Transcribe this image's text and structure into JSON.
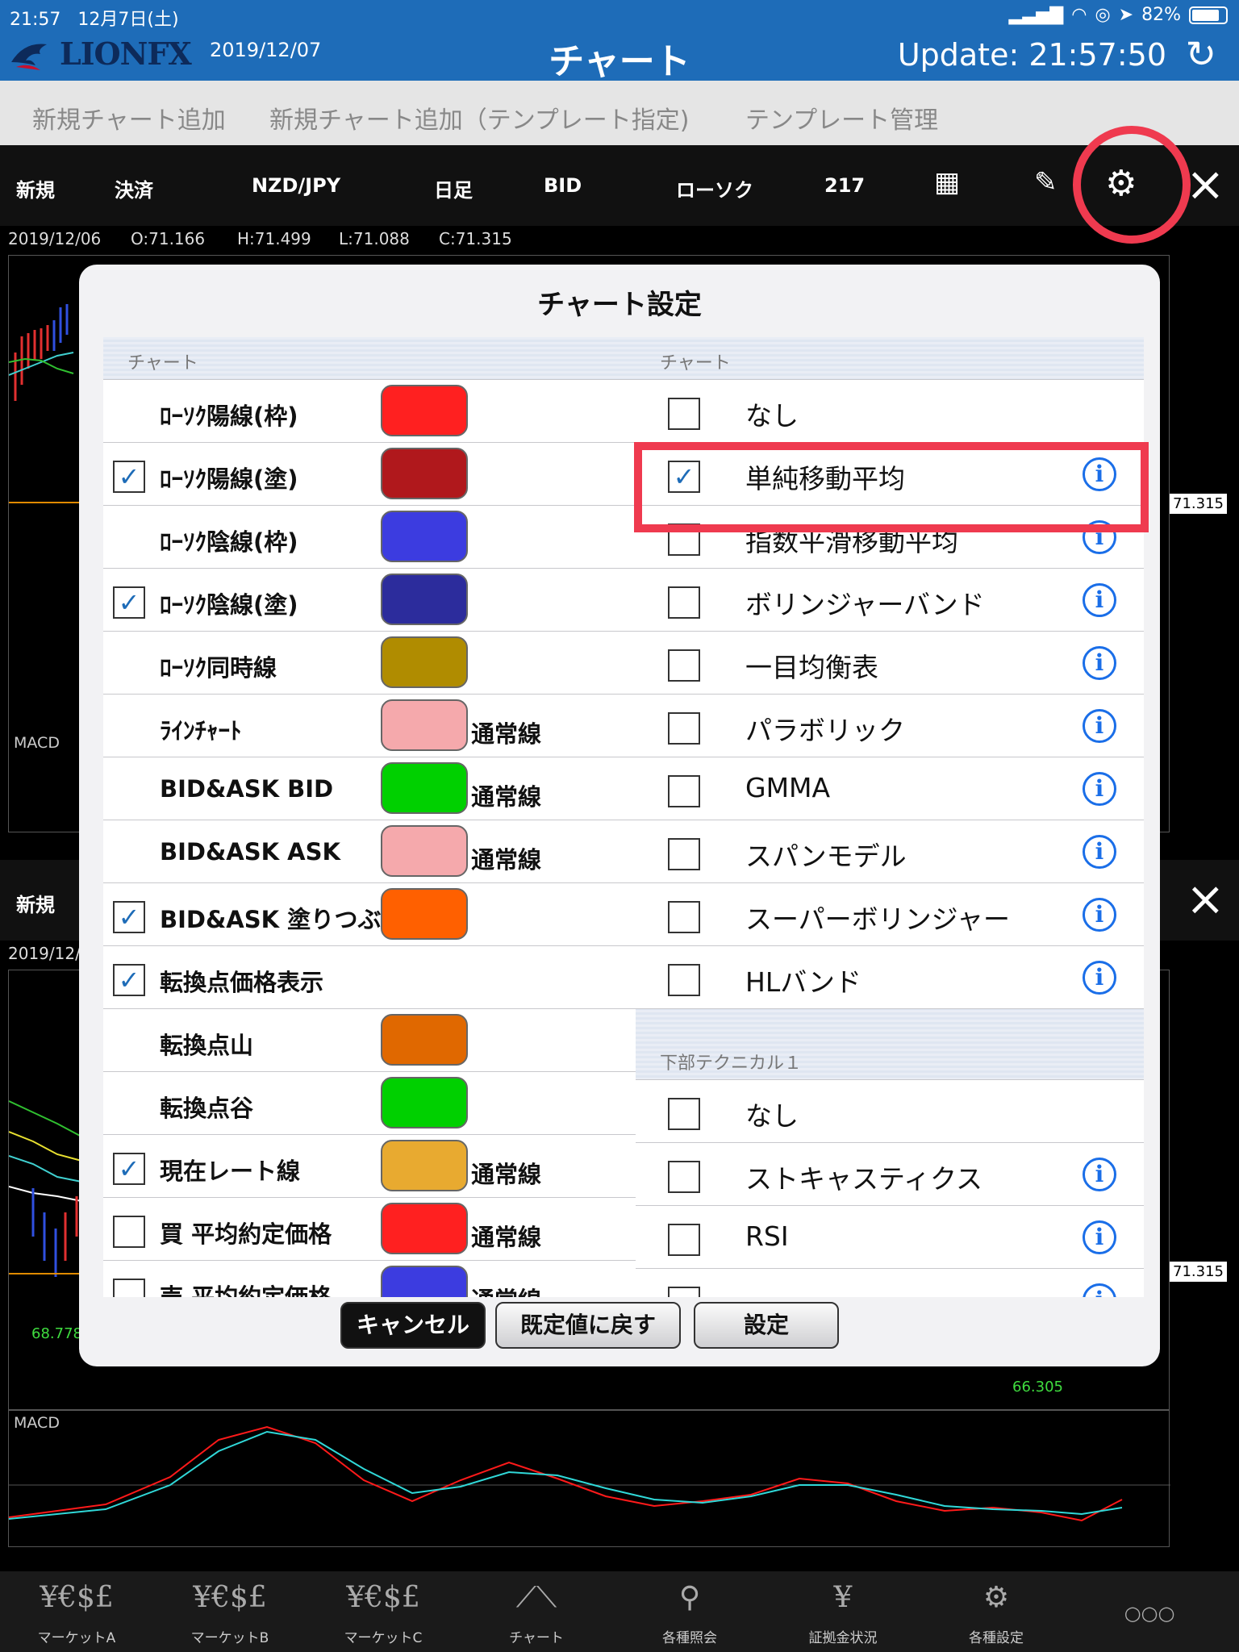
{
  "status_bar": {
    "time": "21:57",
    "date": "12月7日(土)",
    "battery": "82%",
    "battery_level": 0.82
  },
  "header": {
    "logo": "LIONFX",
    "date": "2019/12/07",
    "title": "チャート",
    "update": "Update: 21:57:50"
  },
  "menu": [
    "新規チャート追加",
    "新規チャート追加（テンプレート指定)",
    "テンプレート管理"
  ],
  "toolbar_top": {
    "new": "新規",
    "settle": "決済",
    "pair": "NZD/JPY",
    "period": "日足",
    "side": "BID",
    "style": "ローソク",
    "count": "217"
  },
  "ohlc": {
    "date": "2019/12/06",
    "open": "O:71.166",
    "high": "H:71.499",
    "low": "L:71.088",
    "close": "C:71.315"
  },
  "chart_labels": {
    "macd": "MACD",
    "price_tag": "71.315",
    "low_label": "68.778",
    "low_label2": "66.305",
    "date_partial": "2019/12/"
  },
  "toolbar_bottom": {
    "new": "新規"
  },
  "modal": {
    "title": "チャート設定",
    "left_section": "チャート",
    "left_rows": [
      {
        "label": "ﾛｰｿｸ陽線(枠)",
        "checked": false,
        "has_check": false,
        "color": "#ff2020",
        "line": ""
      },
      {
        "label": "ﾛｰｿｸ陽線(塗)",
        "checked": true,
        "has_check": true,
        "color": "#b0181c",
        "line": ""
      },
      {
        "label": "ﾛｰｿｸ陰線(枠)",
        "checked": false,
        "has_check": false,
        "color": "#3c3ce0",
        "line": ""
      },
      {
        "label": "ﾛｰｿｸ陰線(塗)",
        "checked": true,
        "has_check": true,
        "color": "#2c2c9c",
        "line": ""
      },
      {
        "label": "ﾛｰｿｸ同時線",
        "checked": false,
        "has_check": false,
        "color": "#b08c00",
        "line": ""
      },
      {
        "label": "ﾗｲﾝﾁｬｰﾄ",
        "checked": false,
        "has_check": false,
        "color": "#f5a9ac",
        "line": "通常線"
      },
      {
        "label": "BID&ASK BID",
        "checked": false,
        "has_check": false,
        "color": "#00d000",
        "line": "通常線"
      },
      {
        "label": "BID&ASK ASK",
        "checked": false,
        "has_check": false,
        "color": "#f5a9ac",
        "line": "通常線"
      },
      {
        "label": "BID&ASK 塗りつぶし",
        "checked": true,
        "has_check": true,
        "color": "#ff6000",
        "line": ""
      },
      {
        "label": "転換点価格表示",
        "checked": true,
        "has_check": true,
        "color": "",
        "line": ""
      },
      {
        "label": "転換点山",
        "checked": false,
        "has_check": false,
        "color": "#e06800",
        "line": ""
      },
      {
        "label": "転換点谷",
        "checked": false,
        "has_check": false,
        "color": "#00d000",
        "line": ""
      },
      {
        "label": "現在レート線",
        "checked": true,
        "has_check": true,
        "color": "#e8aa30",
        "line": "通常線"
      },
      {
        "label": "買 平均約定価格",
        "checked": false,
        "has_check": true,
        "color": "#ff2020",
        "line": "通常線"
      },
      {
        "label": "売 平均約定価格",
        "checked": false,
        "has_check": true,
        "color": "#3c3ce0",
        "line": "通常線"
      }
    ],
    "right_section1": "チャート",
    "right_rows1": [
      {
        "label": "なし",
        "checked": false,
        "info": false
      },
      {
        "label": "単純移動平均",
        "checked": true,
        "info": true
      },
      {
        "label": "指数平滑移動平均",
        "checked": false,
        "info": true
      },
      {
        "label": "ボリンジャーバンド",
        "checked": false,
        "info": true
      },
      {
        "label": "一目均衡表",
        "checked": false,
        "info": true
      },
      {
        "label": "パラボリック",
        "checked": false,
        "info": true
      },
      {
        "label": "GMMA",
        "checked": false,
        "info": true
      },
      {
        "label": "スパンモデル",
        "checked": false,
        "info": true
      },
      {
        "label": "スーパーボリンジャー",
        "checked": false,
        "info": true
      },
      {
        "label": "HLバンド",
        "checked": false,
        "info": true
      }
    ],
    "right_section2": "下部テクニカル１",
    "right_rows2": [
      {
        "label": "なし",
        "checked": false,
        "info": false
      },
      {
        "label": "ストキャスティクス",
        "checked": false,
        "info": true
      },
      {
        "label": "RSI",
        "checked": false,
        "info": true
      },
      {
        "label": "",
        "checked": false,
        "info": true
      }
    ],
    "buttons": {
      "cancel": "キャンセル",
      "reset": "既定値に戻す",
      "ok": "設定"
    }
  },
  "tabs": [
    {
      "icon": "¥€$£",
      "label": "マーケットA"
    },
    {
      "icon": "¥€$£",
      "label": "マーケットB"
    },
    {
      "icon": "¥€$£",
      "label": "マーケットC"
    },
    {
      "icon": "chart-icon",
      "label": "チャート"
    },
    {
      "icon": "search-icon",
      "label": "各種照会"
    },
    {
      "icon": "¥",
      "label": "証拠金状況"
    },
    {
      "icon": "gear-icon",
      "label": "各種設定"
    },
    {
      "icon": "more-icon",
      "label": ""
    }
  ]
}
